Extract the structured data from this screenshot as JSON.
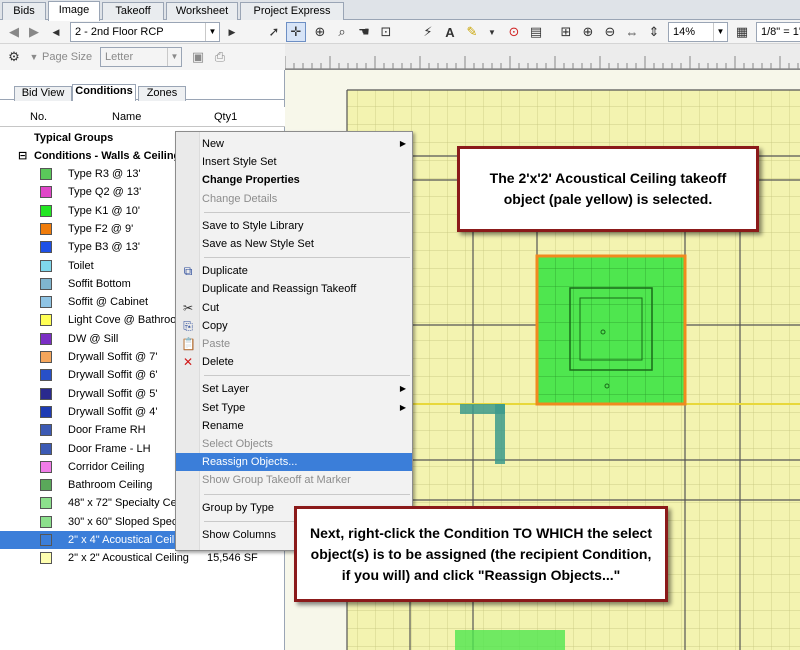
{
  "top_tabs": [
    "Bids",
    "Image",
    "Takeoff",
    "Worksheet",
    "Project Express"
  ],
  "active_tab": "Image",
  "toolbar": {
    "page_select": "2 - 2nd Floor RCP",
    "zoom": "14%",
    "scale": "1/8\" = 1'",
    "page_size_label": "Page Size",
    "page_size_value": "Letter"
  },
  "panel_tabs": [
    "Bid View",
    "Conditions",
    "Zones"
  ],
  "columns": {
    "no": "No.",
    "name": "Name",
    "qty": "Qty1"
  },
  "groups": {
    "typical": "Typical Groups",
    "conditions": "Conditions - Walls & Ceilings"
  },
  "conditions": [
    {
      "name": "Type R3 @ 13'",
      "color": "#5ac85a",
      "qty": ""
    },
    {
      "name": "Type Q2 @ 13'",
      "color": "#e046c8",
      "qty": ""
    },
    {
      "name": "Type K1 @ 10'",
      "color": "#22e622",
      "qty": ""
    },
    {
      "name": "Type F2 @ 9'",
      "color": "#f07c0a",
      "qty": ""
    },
    {
      "name": "Type B3 @ 13'",
      "color": "#1e50e6",
      "qty": ""
    },
    {
      "name": "Toilet",
      "color": "#7fd8ec",
      "qty": ""
    },
    {
      "name": "Soffit Bottom",
      "color": "#7fb5cf",
      "qty": ""
    },
    {
      "name": "Soffit @ Cabinet",
      "color": "#8fc4e4",
      "qty": ""
    },
    {
      "name": "Light Cove @ Bathroom",
      "color": "#ffff55",
      "qty": ""
    },
    {
      "name": "DW @ Sill",
      "color": "#7a2ec4",
      "qty": ""
    },
    {
      "name": "Drywall Soffit @ 7'",
      "color": "#f5a65c",
      "qty": ""
    },
    {
      "name": "Drywall Soffit @ 6'",
      "color": "#2850c8",
      "qty": ""
    },
    {
      "name": "Drywall Soffit @ 5'",
      "color": "#2a2a8e",
      "qty": ""
    },
    {
      "name": "Drywall Soffit @ 4'",
      "color": "#1e3cb4",
      "qty": ""
    },
    {
      "name": "Door Frame RH",
      "color": "#3c5ab4",
      "qty": ""
    },
    {
      "name": "Door Frame - LH",
      "color": "#3c5ab4",
      "qty": ""
    },
    {
      "name": "Corridor Ceiling",
      "color": "#f07ce8",
      "qty": ""
    },
    {
      "name": "Bathroom Ceiling",
      "color": "#5aa85a",
      "qty": ""
    },
    {
      "name": "48\" x 72\" Specialty Ceil",
      "color": "#8ce08c",
      "qty": ""
    },
    {
      "name": "30\" x 60\" Sloped Specia",
      "color": "#8ce08c",
      "qty": ""
    },
    {
      "name": "2\" x 4\" Acoustical Ceilin",
      "color": "#3b7ed9",
      "qty": ""
    },
    {
      "name": "2\" x 2\" Acoustical Ceiling",
      "color": "#ffffb0",
      "qty": "15,546 SF"
    }
  ],
  "context_menu": [
    {
      "label": "New",
      "submenu": true
    },
    {
      "label": "Insert Style Set"
    },
    {
      "label": "Change Properties",
      "bold": true
    },
    {
      "label": "Change Details",
      "disabled": true
    },
    {
      "sep": true
    },
    {
      "label": "Save to Style Library"
    },
    {
      "label": "Save as New Style Set"
    },
    {
      "sep": true
    },
    {
      "label": "Duplicate",
      "icon": "duplicate-icon"
    },
    {
      "label": "Duplicate and Reassign Takeoff"
    },
    {
      "label": "Cut",
      "icon": "cut-icon"
    },
    {
      "label": "Copy",
      "icon": "copy-icon"
    },
    {
      "label": "Paste",
      "icon": "paste-icon",
      "disabled": true
    },
    {
      "label": "Delete",
      "icon": "delete-icon"
    },
    {
      "sep": true
    },
    {
      "label": "Set Layer",
      "submenu": true
    },
    {
      "label": "Set Type",
      "submenu": true
    },
    {
      "label": "Rename"
    },
    {
      "label": "Select Objects",
      "disabled": true
    },
    {
      "label": "Reassign Objects...",
      "highlight": true
    },
    {
      "label": "Show Group Takeoff at Marker",
      "disabled": true
    },
    {
      "sep": true
    },
    {
      "label": "Group by Type"
    },
    {
      "sep": true
    },
    {
      "label": "Show Columns"
    }
  ],
  "callouts": {
    "top": "The 2'x'2' Acoustical Ceiling takeoff object (pale yellow) is selected.",
    "bottom": "Next, right-click the Condition TO WHICH the select object(s) is to be assigned (the recipient Condition, if you will) and click \"Reassign Objects...\""
  },
  "colors": {
    "accent": "#3b7ed9",
    "callout_border": "#8b1a1a",
    "ceiling_area": "#f3f3b0",
    "selected_area": "#3ce63c"
  }
}
